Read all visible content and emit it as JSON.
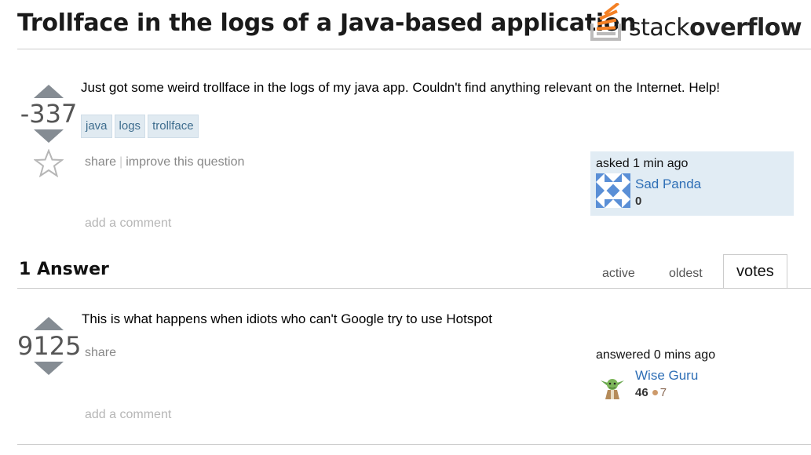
{
  "question": {
    "title": "Trollface in the logs of a Java-based application",
    "body": "Just got some weird trollface in the logs of my java app. Couldn't find anything relevant on the Internet. Help!",
    "votes": "-337",
    "tags": [
      "java",
      "logs",
      "trollface"
    ],
    "menu": {
      "share": "share",
      "separator": "|",
      "improve": "improve this question"
    },
    "add_comment": "add a comment",
    "asked": {
      "action": "asked 1 min ago",
      "user": "Sad Panda",
      "reputation": "0"
    }
  },
  "logo": {
    "text_light": "stack",
    "text_bold": "overflow",
    "colors": {
      "orange": "#f48024",
      "gray": "#bcbbbb"
    }
  },
  "answers": {
    "title": "1 Answer",
    "sort_tabs": [
      {
        "label": "active"
      },
      {
        "label": "oldest"
      },
      {
        "label": "votes"
      }
    ],
    "selected_tab": "votes",
    "items": [
      {
        "body": "This is what happens when idiots who can't Google try to use Hotspot",
        "votes": "9125",
        "menu": {
          "share": "share"
        },
        "add_comment": "add a comment",
        "answered": {
          "action": "answered 0 mins ago",
          "user": "Wise Guru",
          "reputation": "46",
          "bronze_badges": "7"
        }
      }
    ]
  },
  "colors": {
    "link": "#2f6fb6",
    "tag_bg": "#e0eaf1",
    "tag_text": "#3e6d8e",
    "user_card_bg": "#e1ecf4",
    "vote_arrow": "#858c93",
    "bronze": "#cd9a6b"
  }
}
